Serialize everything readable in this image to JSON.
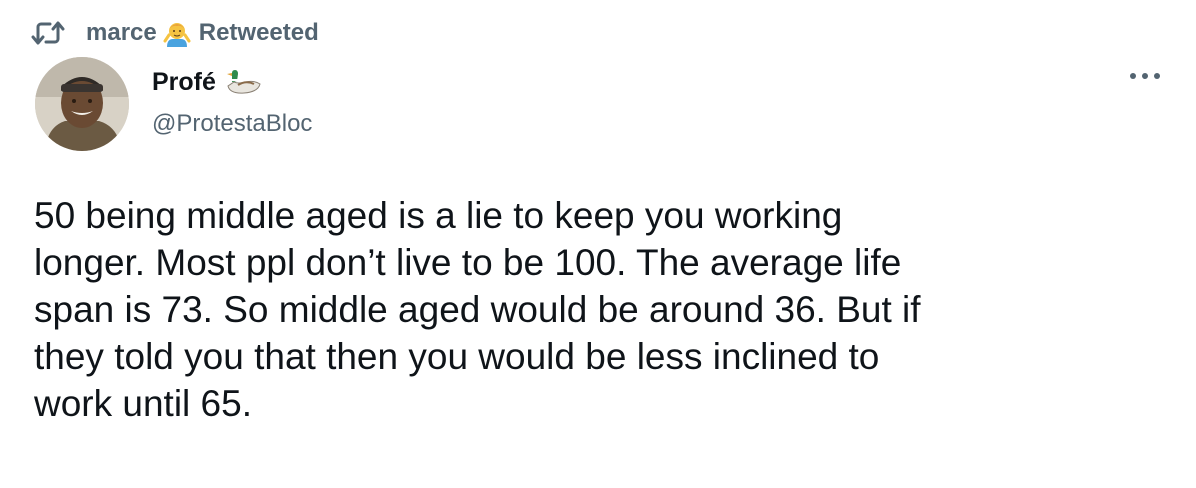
{
  "retweet": {
    "icon": "retweet-icon",
    "user": "marce",
    "emoji": "person-gesturing-emoji",
    "label": "Retweeted"
  },
  "author": {
    "display_name": "Profé",
    "emoji": "duck-emoji",
    "handle": "@ProtestaBloc",
    "avatar": "profile-photo"
  },
  "actions": {
    "more_icon": "more-options-icon"
  },
  "tweet": {
    "text": "50 being middle aged is a lie to keep you working\nlonger. Most ppl don’t live to be 100. The average life\nspan is 73. So middle aged would be around 36. But if\nthey told you that then you would be less inclined to\nwork until 65."
  }
}
